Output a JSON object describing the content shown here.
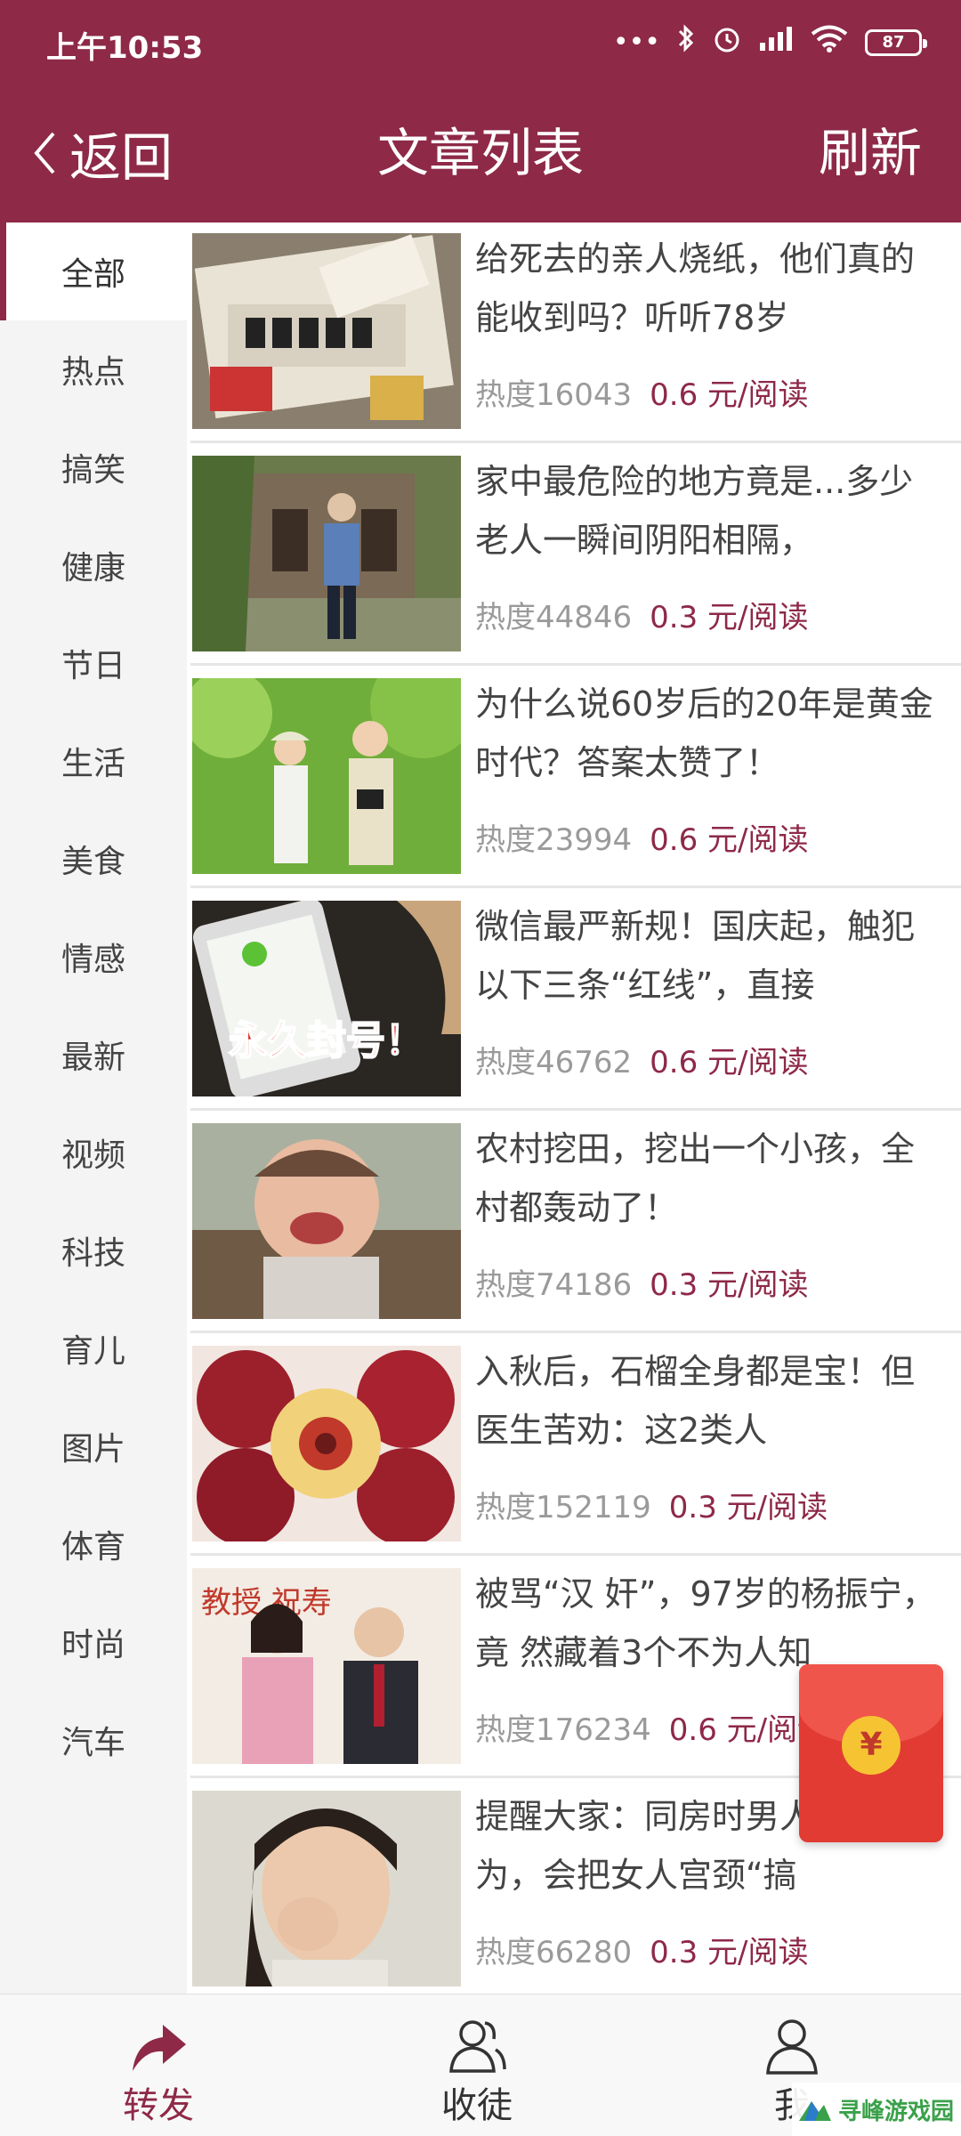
{
  "status_bar": {
    "time": "上午10:53",
    "icons": [
      "more-dots-icon",
      "bluetooth-icon",
      "alarm-icon",
      "signal-icon",
      "wifi-icon"
    ],
    "battery": "87"
  },
  "header": {
    "back_label": "返回",
    "title": "文章列表",
    "refresh_label": "刷新",
    "background_color": "#8e2948"
  },
  "sidebar": {
    "categories": [
      {
        "label": "全部",
        "active": true
      },
      {
        "label": "热点"
      },
      {
        "label": "搞笑"
      },
      {
        "label": "健康"
      },
      {
        "label": "节日"
      },
      {
        "label": "生活"
      },
      {
        "label": "美食"
      },
      {
        "label": "情感"
      },
      {
        "label": "最新"
      },
      {
        "label": "视频"
      },
      {
        "label": "科技"
      },
      {
        "label": "育儿"
      },
      {
        "label": "图片"
      },
      {
        "label": "体育"
      },
      {
        "label": "时尚"
      },
      {
        "label": "汽车"
      }
    ]
  },
  "articles": [
    {
      "title": "给死去的亲人烧纸，他们真的能收到吗？听听78岁",
      "heat": "热度16043",
      "price": "0.6 元/阅读",
      "thumb": "paper-offerings"
    },
    {
      "title": "家中最危险的地方竟是...多少老人一瞬间阴阳相隔，",
      "heat": "热度44846",
      "price": "0.3 元/阅读",
      "thumb": "old-man-courtyard"
    },
    {
      "title": "为什么说60岁后的20年是黄金时代？答案太赞了！",
      "heat": "热度23994",
      "price": "0.6 元/阅读",
      "thumb": "elderly-couple"
    },
    {
      "title": "微信最严新规！国庆起，触犯以下三条“红线”，直接",
      "heat": "热度46762",
      "price": "0.6 元/阅读",
      "thumb": "phone-ban",
      "thumb_text": "永久封号！"
    },
    {
      "title": "农村挖田，挖出一个小孩，全村都轰动了！",
      "heat": "热度74186",
      "price": "0.3 元/阅读",
      "thumb": "crying-child"
    },
    {
      "title": "入秋后，石榴全身都是宝！但医生苦劝：这2类人",
      "heat": "热度152119",
      "price": "0.3 元/阅读",
      "thumb": "pomegranate"
    },
    {
      "title": "被骂“汉 奸”，97岁的杨振宁，竟 然藏着3个不为人知",
      "heat": "热度176234",
      "price": "0.6 元/阅读",
      "thumb": "couple-banner",
      "thumb_text": "教授 祝寿"
    },
    {
      "title": "提醒大家：同房时男人这种行为，会把女人宫颈“搞",
      "heat": "热度66280",
      "price": "0.3 元/阅读",
      "thumb": "crying-woman"
    }
  ],
  "red_packet": {
    "symbol": "¥"
  },
  "bottom_nav": [
    {
      "label": "转发",
      "icon": "share-arrow-icon",
      "active": true
    },
    {
      "label": "收徒",
      "icon": "users-icon"
    },
    {
      "label": "我",
      "icon": "user-icon"
    }
  ],
  "watermark": {
    "text": "寻峰游戏园"
  }
}
